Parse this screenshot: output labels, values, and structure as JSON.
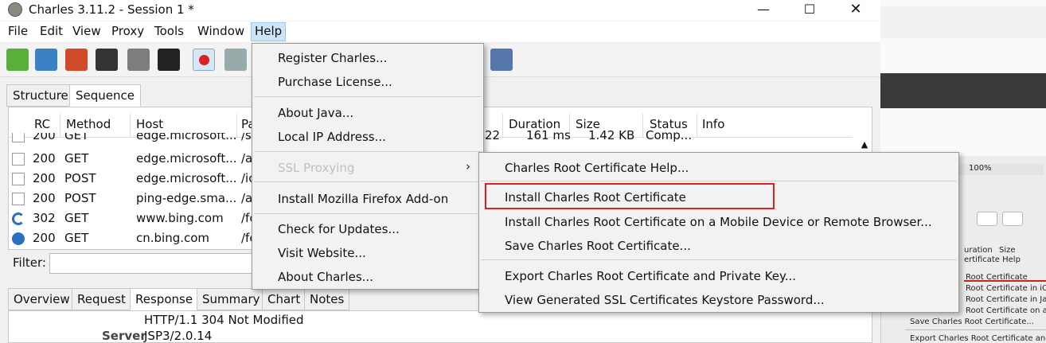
{
  "window": {
    "title": "Charles 3.11.2 - Session 1 *"
  },
  "menubar": [
    "File",
    "Edit",
    "View",
    "Proxy",
    "Tools",
    "Window",
    "Help"
  ],
  "tabs": [
    "Structure",
    "Sequence"
  ],
  "columns": {
    "rc": "RC",
    "method": "Method",
    "host": "Host",
    "path": "Pa",
    "duration": "Duration",
    "size": "Size",
    "status": "Status",
    "info": "Info"
  },
  "rows": [
    {
      "rc": "200",
      "method": "GET",
      "host": "edge.microsoft...",
      "path": "/s",
      "duration": "161 ms",
      "size": "1.42 KB",
      "status": "Comp...",
      "extra": "22"
    },
    {
      "rc": "200",
      "method": "GET",
      "host": "edge.microsoft...",
      "path": "/a"
    },
    {
      "rc": "200",
      "method": "POST",
      "host": "edge.microsoft...",
      "path": "/ic"
    },
    {
      "rc": "200",
      "method": "POST",
      "host": "ping-edge.sma...",
      "path": "/a"
    },
    {
      "rc": "302",
      "method": "GET",
      "host": "www.bing.com",
      "path": "/fc"
    },
    {
      "rc": "200",
      "method": "GET",
      "host": "cn.bing.com",
      "path": "/fc"
    }
  ],
  "filter": {
    "label": "Filter:"
  },
  "bottom_tabs": [
    "Overview",
    "Request",
    "Response",
    "Summary",
    "Chart",
    "Notes"
  ],
  "response": {
    "status_line": "HTTP/1.1 304 Not Modified",
    "server_key": "Server",
    "server_val": "JSP3/2.0.14"
  },
  "help_menu": {
    "register": "Register Charles...",
    "purchase": "Purchase License...",
    "about_java": "About Java...",
    "local_ip": "Local IP Address...",
    "ssl_proxying": "SSL Proxying",
    "firefox": "Install Mozilla Firefox Add-on",
    "updates": "Check for Updates...",
    "website": "Visit Website...",
    "about": "About Charles..."
  },
  "ssl_menu": {
    "help": "Charles Root Certificate Help...",
    "install": "Install Charles Root Certificate",
    "install_mobile": "Install Charles Root Certificate on a Mobile Device or Remote Browser...",
    "save": "Save Charles Root Certificate...",
    "export": "Export Charles Root Certificate and Private Key...",
    "view": "View Generated SSL Certificates Keystore Password..."
  },
  "bg_thumb": {
    "battery": "100%",
    "duration": "uration",
    "size": "Size",
    "help": "ertificate Help",
    "root": "Root Certificate",
    "ios": "Root Certificate in iOS",
    "java": "Root Certificate in Jav",
    "on_a": "Root Certificate on a",
    "save": "Save Charles Root Certificate...",
    "export": "Export Charles Root Certificate and"
  },
  "colors": {
    "highlight_box": "#e02020",
    "menu_bg": "#f2f2f2",
    "active_menu": "#cce4f7"
  }
}
